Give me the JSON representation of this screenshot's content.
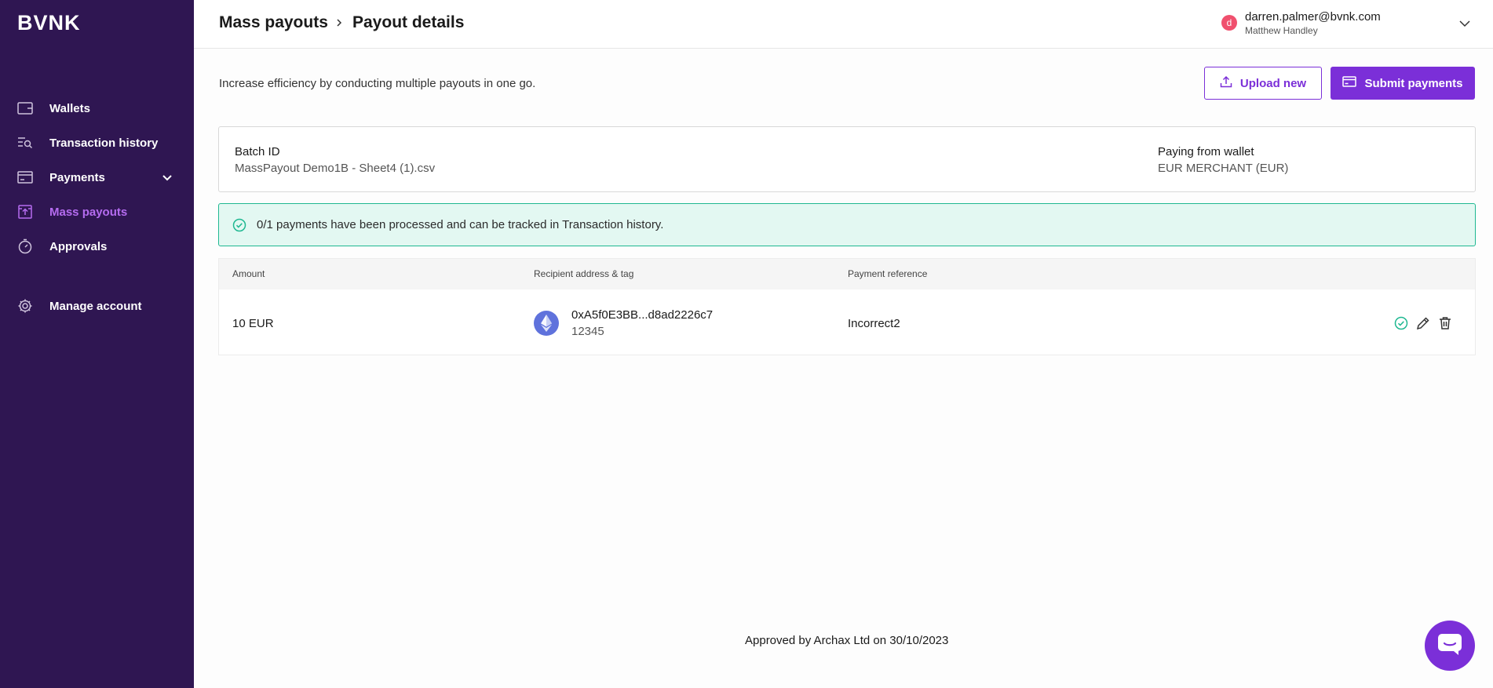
{
  "sidebar": {
    "logo": "BVNK",
    "items": [
      {
        "label": "Wallets",
        "icon": "wallet-icon"
      },
      {
        "label": "Transaction history",
        "icon": "transaction-search-icon"
      },
      {
        "label": "Payments",
        "icon": "card-icon"
      },
      {
        "label": "Mass payouts",
        "icon": "mass-payout-icon",
        "active": true
      },
      {
        "label": "Approvals",
        "icon": "stopwatch-icon"
      },
      {
        "label": "Manage account",
        "icon": "gear-icon"
      }
    ]
  },
  "header": {
    "breadcrumb": [
      "Mass payouts",
      "Payout details"
    ],
    "user": {
      "initial": "d",
      "email": "darren.palmer@bvnk.com",
      "name": "Matthew Handley"
    }
  },
  "main": {
    "intro": "Increase efficiency by conducting multiple payouts in one go.",
    "upload_label": "Upload new",
    "submit_label": "Submit payments",
    "batch": {
      "id_label": "Batch ID",
      "id_value": "MassPayout Demo1B - Sheet4 (1).csv",
      "wallet_label": "Paying from wallet",
      "wallet_value": "EUR MERCHANT (EUR)"
    },
    "notice": "0/1 payments have been processed and can be tracked in Transaction history.",
    "table": {
      "headers": [
        "Amount",
        "Recipient address & tag",
        "Payment reference"
      ],
      "rows": [
        {
          "amount": "10 EUR",
          "address": "0xA5f0E3BB...d8ad2226c7",
          "tag": "12345",
          "reference": "Incorrect2"
        }
      ]
    },
    "footer": "Approved by Archax Ltd on 30/10/2023"
  },
  "colors": {
    "sidebar_bg": "#2f1652",
    "accent": "#7b2fd8",
    "active_nav": "#b56cf0",
    "success": "#1fb891",
    "notice_bg": "#e3f8f2"
  }
}
